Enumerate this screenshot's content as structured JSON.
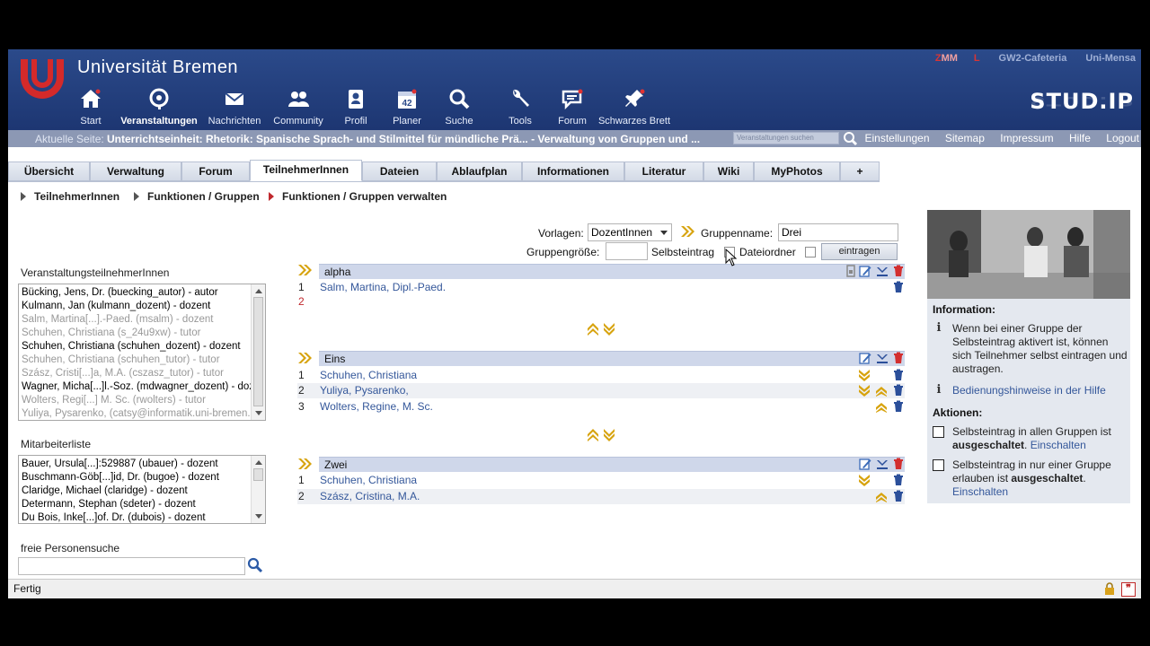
{
  "header": {
    "uni_name": "Universität Bremen",
    "zmml_z": "Z",
    "zmml_mm": "MM",
    "zmml_l": "L",
    "link_cafeteria": "GW2-Cafeteria",
    "link_mensa": "Uni-Mensa",
    "brand": "STUD.IP",
    "nav": [
      {
        "label": "Start",
        "icon": "house-icon"
      },
      {
        "label": "Veranstaltungen",
        "icon": "seminar-icon",
        "active": true
      },
      {
        "label": "Nachrichten",
        "icon": "envelope-icon"
      },
      {
        "label": "Community",
        "icon": "people-icon"
      },
      {
        "label": "Profil",
        "icon": "profile-icon"
      },
      {
        "label": "Planer",
        "icon": "calendar-icon",
        "badge": "42"
      },
      {
        "label": "Suche",
        "icon": "magnifier-icon"
      },
      {
        "label": "Tools",
        "icon": "wrench-icon"
      },
      {
        "label": "Forum",
        "icon": "speech-bubble-icon"
      },
      {
        "label": "Schwarzes Brett",
        "icon": "pin-icon"
      }
    ]
  },
  "locbar": {
    "label": "Aktuelle Seite:",
    "title": "Unterrichtseinheit: Rhetorik: Spanische Sprach- und Stilmittel für mündliche Prä... - Verwaltung von Gruppen und ...",
    "search_placeholder": "Veranstaltungen suchen",
    "links": [
      "Einstellungen",
      "Sitemap",
      "Impressum",
      "Hilfe",
      "Logout"
    ]
  },
  "tabs": [
    "Übersicht",
    "Verwaltung",
    "Forum",
    "TeilnehmerInnen",
    "Dateien",
    "Ablaufplan",
    "Informationen",
    "Literatur",
    "Wiki",
    "MyPhotos",
    "+"
  ],
  "active_tab": "TeilnehmerInnen",
  "breadcrumbs": [
    "TeilnehmerInnen",
    "Funktionen / Gruppen",
    "Funktionen / Gruppen verwalten"
  ],
  "left": {
    "participants_label": "VeranstaltungsteilnehmerInnen",
    "participants": [
      {
        "text": "Bücking, Jens, Dr. (buecking_autor) - autor",
        "grey": false
      },
      {
        "text": "Kulmann, Jan (kulmann_dozent) - dozent",
        "grey": false
      },
      {
        "text": "Salm, Martina[...].-Paed. (msalm) - dozent",
        "grey": true
      },
      {
        "text": "Schuhen, Christiana (s_24u9xw) - tutor",
        "grey": true
      },
      {
        "text": "Schuhen, Christiana (schuhen_dozent) - dozent",
        "grey": false
      },
      {
        "text": "Schuhen, Christiana (schuhen_tutor) - tutor",
        "grey": true
      },
      {
        "text": "Szász, Cristi[...]a, M.A. (cszasz_tutor) - tutor",
        "grey": true
      },
      {
        "text": "Wagner, Micha[...]l.-Soz. (mdwagner_dozent) - dozent",
        "grey": false
      },
      {
        "text": "Wolters, Regi[...] M. Sc. (rwolters) - tutor",
        "grey": true
      },
      {
        "text": "Yuliya, Pysarenko, (catsy@informatik.uni-bremen.de)",
        "grey": true
      }
    ],
    "staff_label": "Mitarbeiterliste",
    "staff": [
      "Bauer, Ursula[...]:529887 (ubauer) - dozent",
      "Buschmann-Göb[...]id, Dr. (bugoe) - dozent",
      "Claridge, Michael (claridge) - dozent",
      "Determann, Stephan (sdeter) - dozent",
      "Du Bois, Inke[...]of. Dr. (dubois) - dozent"
    ],
    "free_search_label": "freie Personensuche"
  },
  "form": {
    "vorlagen_label": "Vorlagen:",
    "vorlagen_value": "DozentInnen",
    "gruppenname_label": "Gruppenname:",
    "gruppenname_value": "Drei",
    "gruppengroesse_label": "Gruppengröße:",
    "gruppengroesse_value": "",
    "selbsteintrag_label": "Selbsteintrag",
    "dateiordner_label": "Dateiordner",
    "submit_label": "eintragen"
  },
  "groups": [
    {
      "name": "alpha",
      "members": [
        "Salm, Martina, Dipl.-Paed.",
        ""
      ],
      "slot_red": "2"
    },
    {
      "name": "Eins",
      "members": [
        "Schuhen, Christiana",
        "Yuliya, Pysarenko,",
        "Wolters, Regine, M. Sc."
      ]
    },
    {
      "name": "Zwei",
      "members": [
        "Schuhen, Christiana",
        "Szász, Cristina, M.A."
      ]
    }
  ],
  "info": {
    "info_heading": "Information:",
    "info_text": "Wenn bei einer Gruppe der Selbsteintrag aktivert ist, können sich Teilnehmer selbst eintragen und austragen.",
    "help_link": "Bedienungshinweise in der Hilfe",
    "actions_heading": "Aktionen:",
    "action1_pre": "Selbsteintrag in allen Gruppen ist ",
    "action1_bold": "ausgeschaltet",
    "action1_post": ". ",
    "action1_link": "Einschalten",
    "action2_pre": "Selbsteintrag in nur einer Gruppe erlauben ist ",
    "action2_bold": "ausgeschaltet",
    "action2_post": ".",
    "action2_link": "Einschalten"
  },
  "status": {
    "text": "Fertig",
    "mod_glyph": "❞"
  },
  "colors": {
    "header_blue": "#1d3672",
    "locbar": "#8c98b4",
    "group_head": "#cfd7ea",
    "link": "#34579a",
    "accent_red": "#c0282d",
    "arrow_gold": "#d7a30e"
  }
}
